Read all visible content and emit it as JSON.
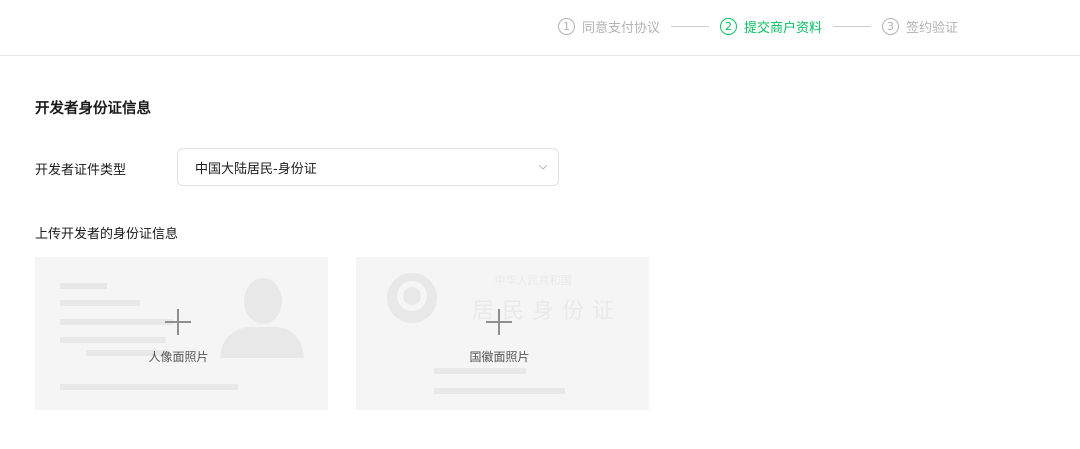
{
  "steps": [
    {
      "num": "1",
      "label": "同意支付协议",
      "active": false
    },
    {
      "num": "2",
      "label": "提交商户资料",
      "active": true
    },
    {
      "num": "3",
      "label": "签约验证",
      "active": false
    }
  ],
  "section": {
    "title": "开发者身份证信息"
  },
  "id_type": {
    "label": "开发者证件类型",
    "selected": "中国大陆居民-身份证"
  },
  "upload": {
    "label": "上传开发者的身份证信息",
    "front_caption": "人像面照片",
    "back_caption": "国徽面照片",
    "back_watermark_line1": "中华人民共和国",
    "back_watermark_line2": "居民身份证"
  },
  "colors": {
    "accent": "#07c160",
    "muted": "#b2b2b2"
  }
}
